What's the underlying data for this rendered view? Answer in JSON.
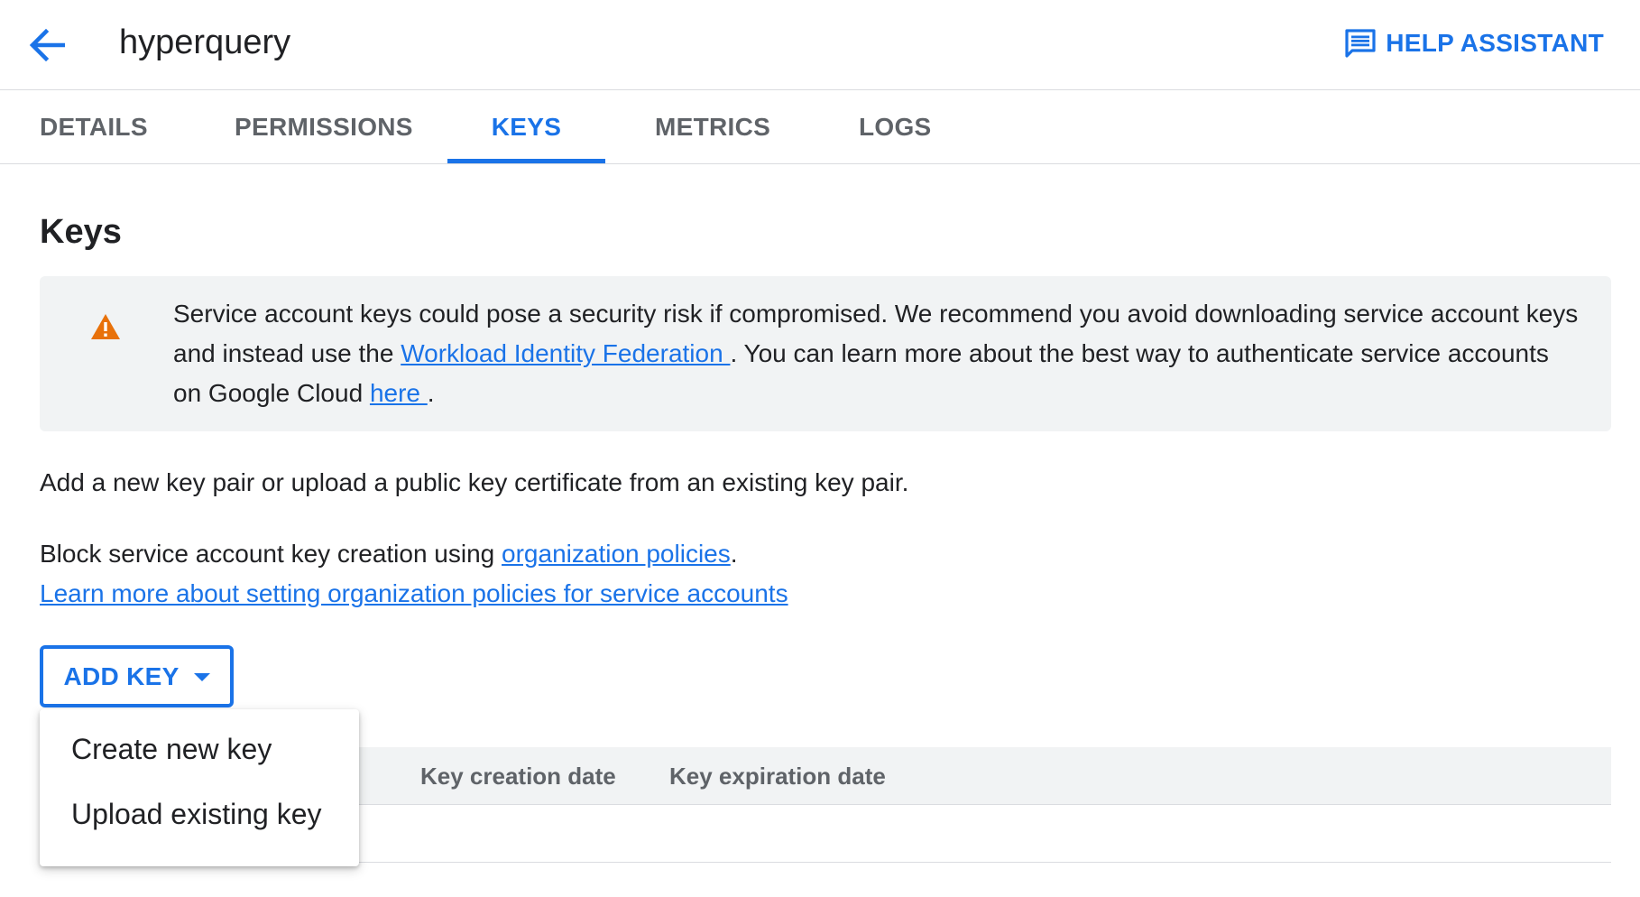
{
  "header": {
    "title": "hyperquery",
    "back_icon": "arrow-left-icon",
    "help_label": "HELP ASSISTANT",
    "help_icon": "chat-icon"
  },
  "tabs": [
    {
      "label": "DETAILS",
      "active": false
    },
    {
      "label": "PERMISSIONS",
      "active": false
    },
    {
      "label": "KEYS",
      "active": true
    },
    {
      "label": "METRICS",
      "active": false
    },
    {
      "label": "LOGS",
      "active": false
    }
  ],
  "main": {
    "title": "Keys",
    "warning": {
      "icon": "warning-icon",
      "text_1": "Service account keys could pose a security risk if compromised. We recommend you avoid downloading service account keys and instead use the ",
      "link_1": "Workload Identity Federation ",
      "text_2": ". You can learn more about the best way to authenticate service accounts on Google Cloud ",
      "link_2": "here ",
      "text_3": "."
    },
    "intro": "Add a new key pair or upload a public key certificate from an existing key pair.",
    "block_text": "Block service account key creation using ",
    "block_link": "organization policies",
    "block_end": ".",
    "learn_more": "Learn more about setting organization policies for service accounts",
    "add_key_label": "ADD KEY",
    "add_key_menu": [
      "Create new key",
      "Upload existing key"
    ],
    "table": {
      "columns": [
        "Key creation date",
        "Key expiration date"
      ]
    }
  },
  "colors": {
    "accent": "#1a73e8",
    "warning": "#e8710a",
    "muted_text": "#5f6368"
  }
}
